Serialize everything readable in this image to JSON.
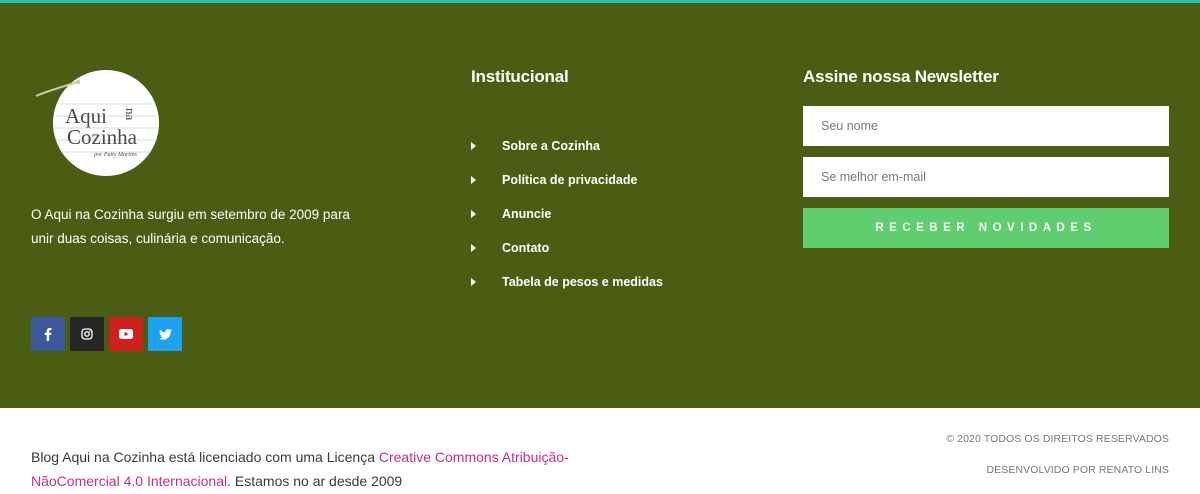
{
  "brand": {
    "logo_line1": "Aqui",
    "logo_na": "na",
    "logo_line2": "Cozinha",
    "logo_byline": "por Patty Martins"
  },
  "about": {
    "text": "O Aqui na Cozinha surgiu em setembro de 2009 para unir duas coisas, culinária e comunicação."
  },
  "social": [
    {
      "name": "facebook",
      "color": "#3b5998"
    },
    {
      "name": "instagram",
      "color": "#262626"
    },
    {
      "name": "youtube",
      "color": "#cd201f"
    },
    {
      "name": "twitter",
      "color": "#1da1f2"
    }
  ],
  "institutional": {
    "title": "Institucional",
    "links": [
      "Sobre a Cozinha",
      "Política de privacidade",
      "Anuncie",
      "Contato",
      "Tabela de pesos e medidas"
    ]
  },
  "newsletter": {
    "title": "Assine nossa Newsletter",
    "name_placeholder": "Seu nome",
    "email_placeholder": "Se melhor em-mail",
    "submit_label": "RECEBER NOVIDADES"
  },
  "footer": {
    "license_prefix": "Blog Aqui na Cozinha está licenciado com uma Licença ",
    "license_link": "Creative Commons Atribuição-NãoComercial 4.0 Internacional",
    "license_suffix": ". Estamos no ar desde 2009",
    "copyright": "© 2020 TODOS OS DIREITOS RESERVADOS",
    "developer": "DESENVOLVIDO POR RENATO LINS"
  },
  "colors": {
    "footer_bg": "#4a5d12",
    "accent_strip": "#1fc4b0",
    "button_green": "#5fce6e",
    "link_pink": "#c5307f"
  }
}
